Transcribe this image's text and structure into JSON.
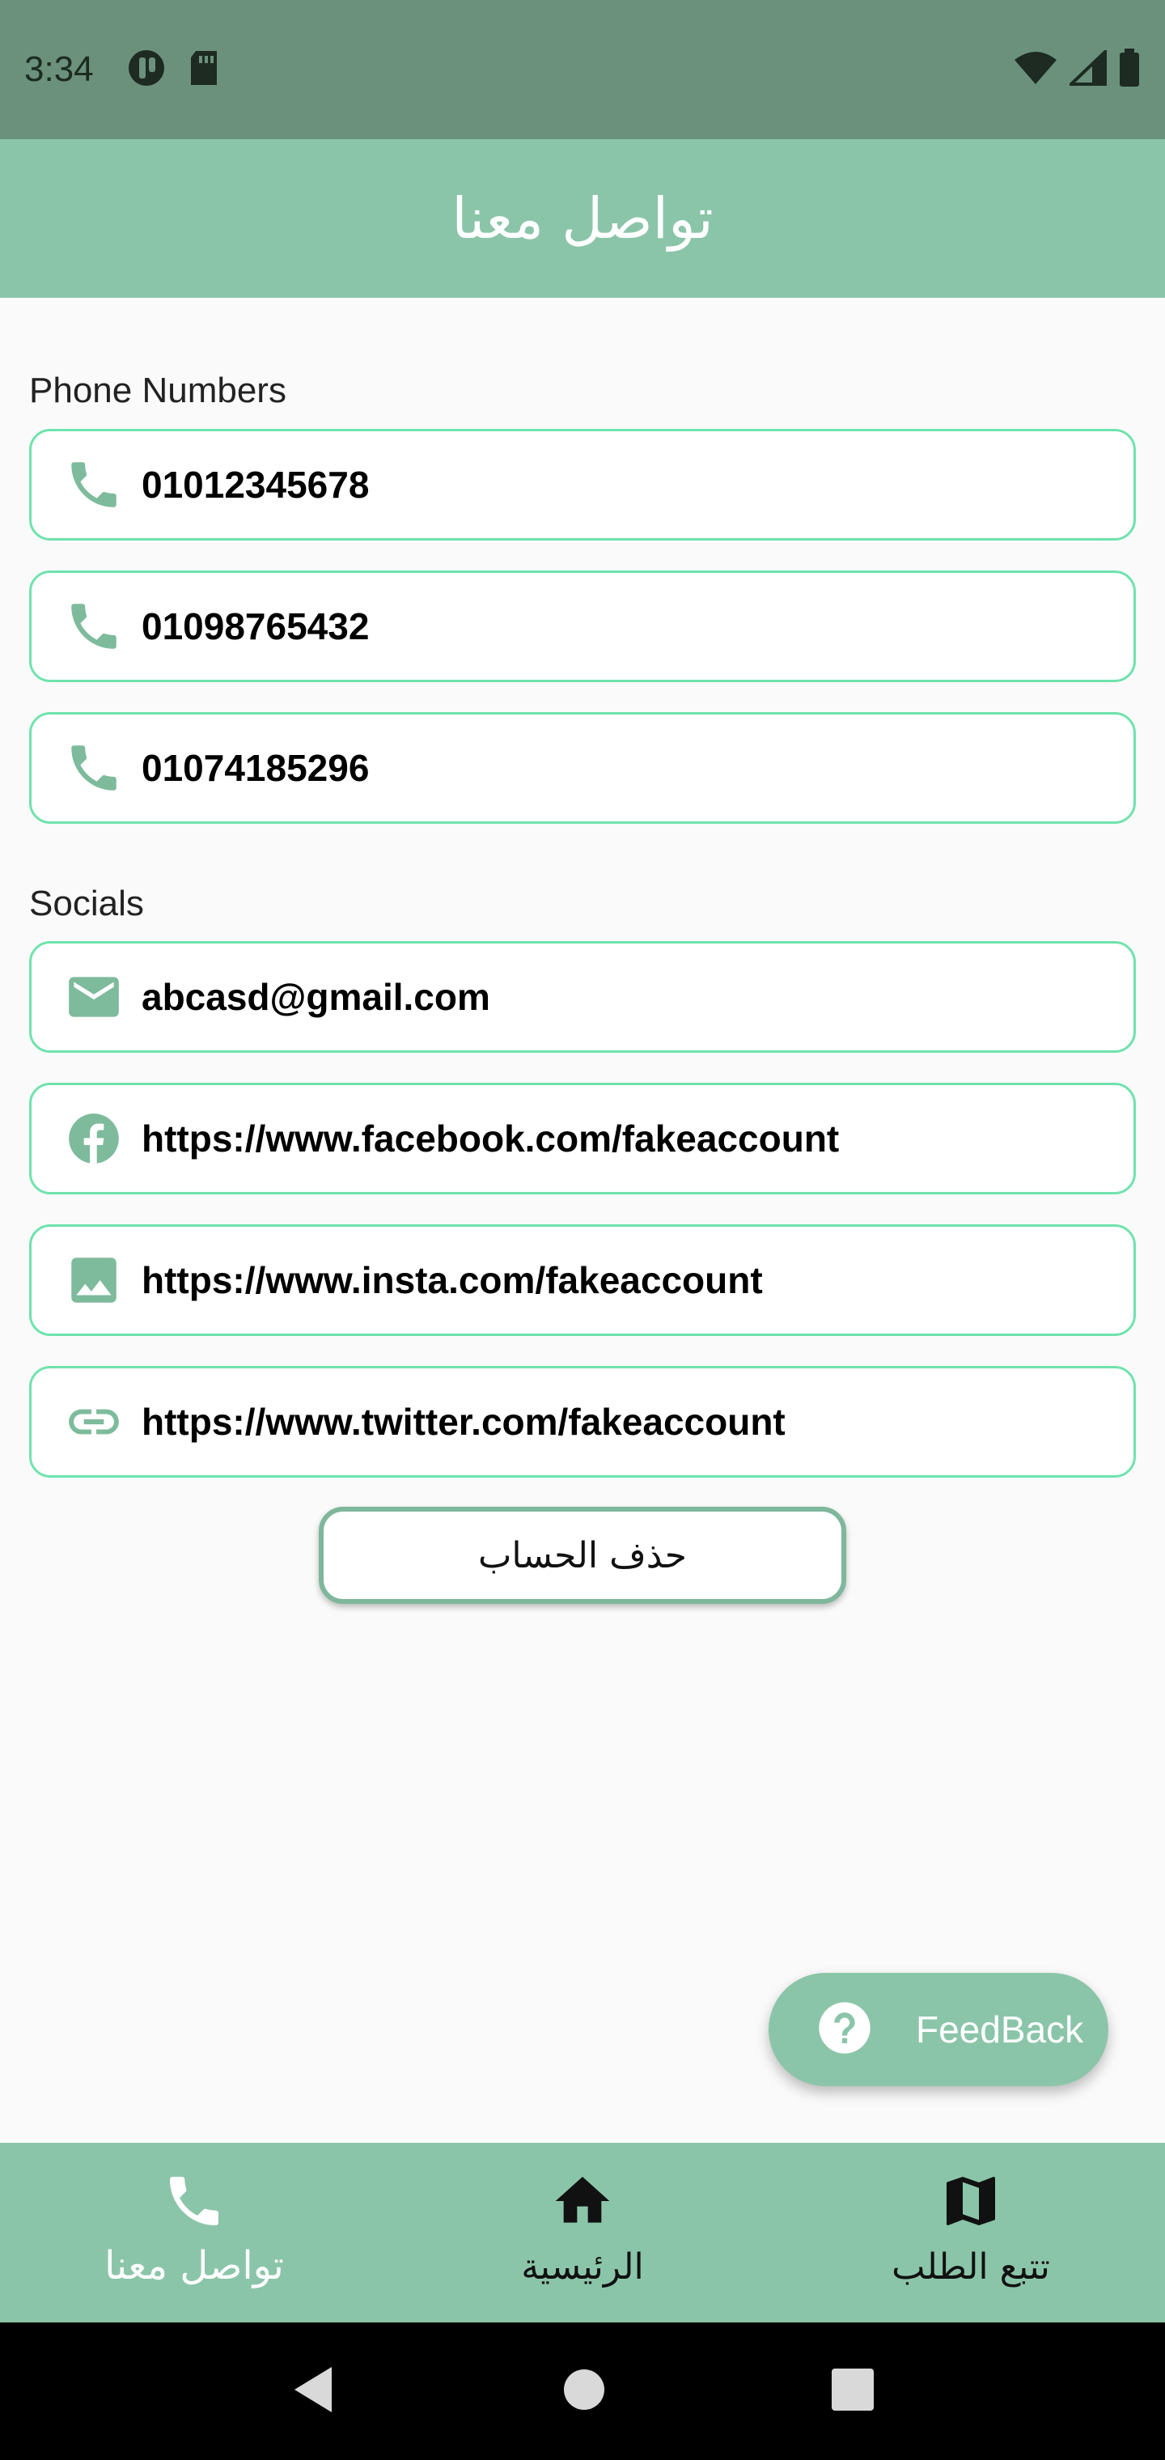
{
  "status_bar": {
    "time": "3:34"
  },
  "app_bar": {
    "title": "تواصل معنا"
  },
  "phone_section": {
    "label": "Phone Numbers",
    "items": [
      {
        "icon": "phone-icon",
        "text": "01012345678"
      },
      {
        "icon": "phone-icon",
        "text": "01098765432"
      },
      {
        "icon": "phone-icon",
        "text": "01074185296"
      }
    ]
  },
  "socials_section": {
    "label": "Socials",
    "items": [
      {
        "icon": "email-icon",
        "text": "abcasd@gmail.com"
      },
      {
        "icon": "facebook-icon",
        "text": "https://www.facebook.com/fakeaccount"
      },
      {
        "icon": "image-icon",
        "text": "https://www.insta.com/fakeaccount"
      },
      {
        "icon": "link-icon",
        "text": "https://www.twitter.com/fakeaccount"
      }
    ]
  },
  "delete_button": {
    "label": "حذف الحساب"
  },
  "fab": {
    "label": "FeedBack"
  },
  "bottom_nav": {
    "items": [
      {
        "label": "تواصل معنا",
        "icon": "phone-icon",
        "active": true
      },
      {
        "label": "الرئيسية",
        "icon": "home-icon",
        "active": false
      },
      {
        "label": "تتبع الطلب",
        "icon": "map-icon",
        "active": false
      }
    ]
  },
  "colors": {
    "status_bar": "#6b917c",
    "primary": "#8bc5a9",
    "card_border": "#6fe3ad",
    "icon": "#7dbb9c"
  }
}
